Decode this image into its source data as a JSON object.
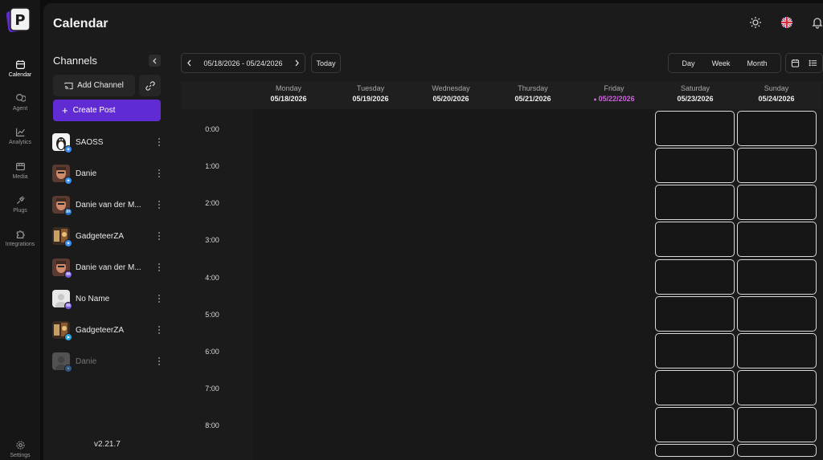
{
  "app": {
    "logo_letter": "P",
    "brand_color": "#612bd3",
    "accent_today": "#d062e0"
  },
  "nav": [
    {
      "label": "Calendar",
      "icon": "calendar-icon",
      "active": true
    },
    {
      "label": "Agent",
      "icon": "chat-icon",
      "active": false
    },
    {
      "label": "Analytics",
      "icon": "chart-icon",
      "active": false
    },
    {
      "label": "Media",
      "icon": "media-icon",
      "active": false
    },
    {
      "label": "Plugs",
      "icon": "plug-icon",
      "active": false
    },
    {
      "label": "Integrations",
      "icon": "puzzle-icon",
      "active": false
    },
    {
      "label": "Settings",
      "icon": "gear-icon",
      "active": false
    }
  ],
  "header": {
    "title": "Calendar",
    "icons": [
      "sun-icon",
      "uk-flag-icon",
      "bell-icon"
    ]
  },
  "sidebar": {
    "title": "Channels",
    "add_channel_label": "Add Channel",
    "create_post_label": "Create Post",
    "version": "v2.21.7",
    "channels": [
      {
        "name": "SAOSS",
        "avatar": "penguin-avatar",
        "platform": "bluesky",
        "badge_color": "#3b8ff0",
        "disabled": false
      },
      {
        "name": "Danie",
        "avatar": "person-avatar",
        "platform": "bluesky",
        "badge_color": "#3b8ff0",
        "disabled": false
      },
      {
        "name": "Danie van der M...",
        "avatar": "person-avatar",
        "platform": "linkedin",
        "badge_color": "#1f73c6",
        "disabled": false
      },
      {
        "name": "GadgeteerZA",
        "avatar": "gadget-avatar",
        "platform": "bluesky",
        "badge_color": "#3b8ff0",
        "disabled": false
      },
      {
        "name": "Danie van der M...",
        "avatar": "person-avatar",
        "platform": "mastodon",
        "badge_color": "#7a5ce0",
        "disabled": false
      },
      {
        "name": "No Name",
        "avatar": "default-avatar",
        "platform": "mastodon",
        "badge_color": "#7a5ce0",
        "disabled": false
      },
      {
        "name": "GadgeteerZA",
        "avatar": "gadget-avatar",
        "platform": "telegram",
        "badge_color": "#2aa3d8",
        "disabled": false
      },
      {
        "name": "Danie",
        "avatar": "default-avatar",
        "platform": "bluesky",
        "badge_color": "#3b8ff0",
        "disabled": true
      }
    ]
  },
  "toolbar": {
    "date_range": "05/18/2026 - 05/24/2026",
    "today_label": "Today",
    "views": [
      "Day",
      "Week",
      "Month"
    ],
    "mode_icons": [
      "calendar-view-icon",
      "list-view-icon"
    ]
  },
  "week": {
    "days": [
      {
        "name": "Monday",
        "date": "05/18/2026",
        "current": false
      },
      {
        "name": "Tuesday",
        "date": "05/19/2026",
        "current": false
      },
      {
        "name": "Wednesday",
        "date": "05/20/2026",
        "current": false
      },
      {
        "name": "Thursday",
        "date": "05/21/2026",
        "current": false
      },
      {
        "name": "Friday",
        "date": "05/22/2026",
        "current": true
      },
      {
        "name": "Saturday",
        "date": "05/23/2026",
        "current": false
      },
      {
        "name": "Sunday",
        "date": "05/24/2026",
        "current": false
      }
    ],
    "hours": [
      "0:00",
      "1:00",
      "2:00",
      "3:00",
      "4:00",
      "5:00",
      "6:00",
      "7:00",
      "8:00"
    ],
    "open_slot_days": [
      "Saturday",
      "Sunday"
    ]
  }
}
